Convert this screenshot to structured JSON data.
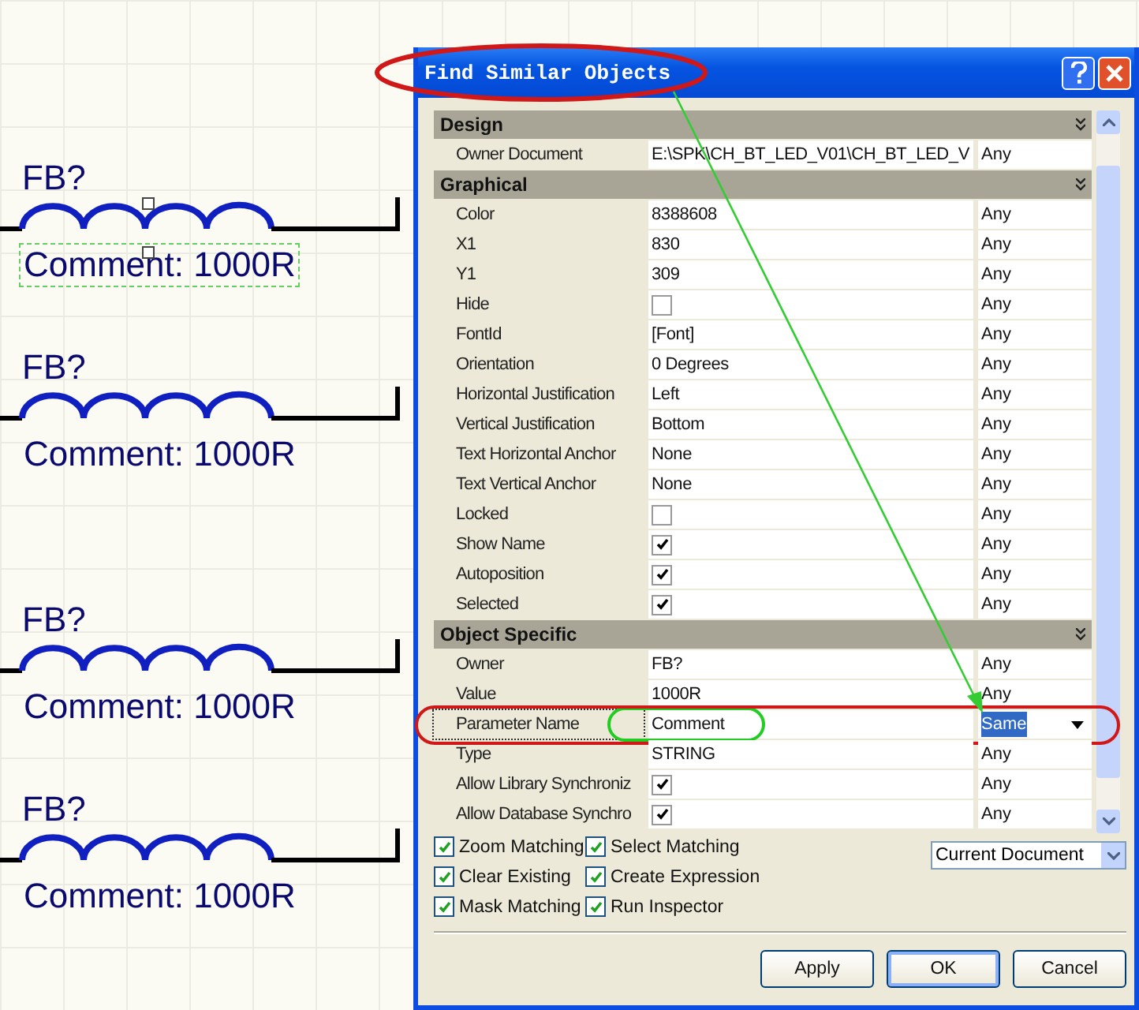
{
  "schematic": {
    "parts": [
      {
        "designator": "FB?",
        "comment": "Comment: 1000R",
        "selected": true
      },
      {
        "designator": "FB?",
        "comment": "Comment: 1000R",
        "selected": false
      },
      {
        "designator": "FB?",
        "comment": "Comment: 1000R",
        "selected": false
      },
      {
        "designator": "FB?",
        "comment": "Comment: 1000R",
        "selected": false
      }
    ]
  },
  "dialog": {
    "title": "Find Similar Objects",
    "sections": [
      {
        "title": "Design",
        "rows": [
          {
            "name": "Owner Document",
            "kind": "text",
            "value": "E:\\SPK\\CH_BT_LED_V01\\CH_BT_LED_V",
            "match": "Any",
            "selected": false
          }
        ]
      },
      {
        "title": "Graphical",
        "rows": [
          {
            "name": "Color",
            "kind": "text",
            "value": "8388608",
            "match": "Any",
            "selected": false
          },
          {
            "name": "X1",
            "kind": "text",
            "value": "830",
            "match": "Any",
            "selected": false
          },
          {
            "name": "Y1",
            "kind": "text",
            "value": "309",
            "match": "Any",
            "selected": false
          },
          {
            "name": "Hide",
            "kind": "check",
            "checked": false,
            "match": "Any",
            "selected": false
          },
          {
            "name": "FontId",
            "kind": "text",
            "value": "[Font]",
            "match": "Any",
            "selected": false
          },
          {
            "name": "Orientation",
            "kind": "text",
            "value": "0 Degrees",
            "match": "Any",
            "selected": false
          },
          {
            "name": "Horizontal Justification",
            "kind": "text",
            "value": "Left",
            "match": "Any",
            "selected": false
          },
          {
            "name": "Vertical Justification",
            "kind": "text",
            "value": "Bottom",
            "match": "Any",
            "selected": false
          },
          {
            "name": "Text Horizontal Anchor",
            "kind": "text",
            "value": "None",
            "match": "Any",
            "selected": false
          },
          {
            "name": "Text Vertical Anchor",
            "kind": "text",
            "value": "None",
            "match": "Any",
            "selected": false
          },
          {
            "name": "Locked",
            "kind": "check",
            "checked": false,
            "match": "Any",
            "selected": false
          },
          {
            "name": "Show Name",
            "kind": "check",
            "checked": true,
            "match": "Any",
            "selected": false
          },
          {
            "name": "Autoposition",
            "kind": "check",
            "checked": true,
            "match": "Any",
            "selected": false
          },
          {
            "name": "Selected",
            "kind": "check",
            "checked": true,
            "match": "Any",
            "selected": false
          }
        ]
      },
      {
        "title": "Object Specific",
        "rows": [
          {
            "name": "Owner",
            "kind": "text",
            "value": "FB?",
            "match": "Any",
            "selected": false
          },
          {
            "name": "Value",
            "kind": "text",
            "value": "1000R",
            "match": "Any",
            "selected": false
          },
          {
            "name": "Parameter Name",
            "kind": "text",
            "value": "Comment",
            "match": "Same",
            "selected": true
          },
          {
            "name": "Type",
            "kind": "text",
            "value": "STRING",
            "match": "Any",
            "selected": false
          },
          {
            "name": "Allow Library Synchroniz",
            "kind": "check",
            "checked": true,
            "match": "Any",
            "selected": false
          },
          {
            "name": "Allow Database Synchro",
            "kind": "check",
            "checked": true,
            "match": "Any",
            "selected": false
          }
        ]
      }
    ],
    "options": [
      {
        "label": "Zoom Matching",
        "checked": true
      },
      {
        "label": "Select Matching",
        "checked": true
      },
      {
        "label": "Clear Existing",
        "checked": true
      },
      {
        "label": "Create Expression",
        "checked": true
      },
      {
        "label": "Mask Matching",
        "checked": true
      },
      {
        "label": "Run Inspector",
        "checked": true
      }
    ],
    "scope": "Current Document",
    "buttons": [
      {
        "label": "Apply",
        "default": false
      },
      {
        "label": "OK",
        "default": true
      },
      {
        "label": "Cancel",
        "default": false
      }
    ]
  }
}
